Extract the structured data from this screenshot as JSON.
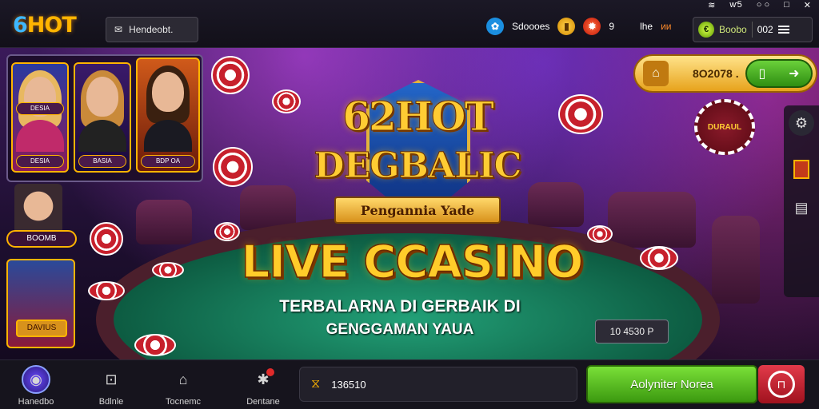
{
  "topbar": {
    "logo_number": "6",
    "logo_word": "HOT",
    "home_label": "Hendeobt.",
    "status_wifi": "≋",
    "status_signal": "ⱳ5",
    "status_clock": "○ ○",
    "win_restore": "□",
    "win_close": "✕",
    "badge1_label": "Sdoooes",
    "badge3_label": "9",
    "badge4_label": "lhe",
    "badge4_value": "ᴎᴎ",
    "wallet_label": "Boobo",
    "wallet_value": "002"
  },
  "posters": {
    "card1_tag": "DESIA",
    "card2_tag": "BASIA",
    "card3_tag": "BDP OA",
    "card1b_tag": "DESIA",
    "side_person_tag": "BOOMB",
    "side_card_tag": "DAVIUS"
  },
  "emblem": {
    "line1": "62HOT",
    "line2": "DEGBALIC",
    "ribbon": "Pengannia Yade"
  },
  "headline": {
    "title": "LIVE CCASINO",
    "sub1": "TERBALARNA DI GERBAIK DI",
    "sub2": "GENGGAMAN YAUA"
  },
  "pot_badge": "10 4530 P",
  "deposit": {
    "amount": "8O2078 ."
  },
  "vip_seal": "DURAUL",
  "bottom": {
    "nav": [
      {
        "label": "Hanedbo"
      },
      {
        "label": "Bdlnle"
      },
      {
        "label": "Tocnemc"
      },
      {
        "label": "Dentane"
      }
    ],
    "code_value": "136510",
    "cta_label": "Aolyniter Norea"
  },
  "colors": {
    "accent_gold": "#ffcc2a",
    "cta_green": "#5fbf24",
    "danger_red": "#d0202e",
    "table_green": "#138a62"
  }
}
